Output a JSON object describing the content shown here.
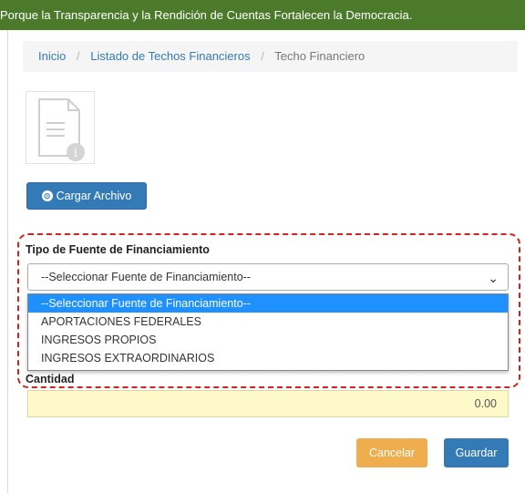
{
  "banner": {
    "text": "Porque la Transparencia y la Rendición de Cuentas Fortalecen la Democracia."
  },
  "breadcrumb": {
    "items": [
      "Inicio",
      "Listado de Techos Financieros"
    ],
    "current": "Techo Financiero",
    "separator": "/"
  },
  "document": {
    "icon": "document-info-icon"
  },
  "upload": {
    "label": "Cargar Archivo",
    "icon": "upload-circle-icon"
  },
  "funding": {
    "label": "Tipo de Fuente de Financiamiento",
    "selected": "--Seleccionar Fuente de Financiamiento--",
    "options": [
      "--Seleccionar Fuente de Financiamiento--",
      "APORTACIONES FEDERALES",
      "INGRESOS PROPIOS",
      "INGRESOS EXTRAORDINARIOS"
    ]
  },
  "amount": {
    "label": "Cantidad",
    "value": "0.00"
  },
  "actions": {
    "cancel": "Cancelar",
    "save": "Guardar"
  },
  "colors": {
    "banner": "#4b7a2a",
    "primary": "#337ab7",
    "warning": "#f0ad4e",
    "highlight": "#d62020",
    "option_selected": "#1e90ff",
    "amount_bg": "#fdf9c9"
  }
}
